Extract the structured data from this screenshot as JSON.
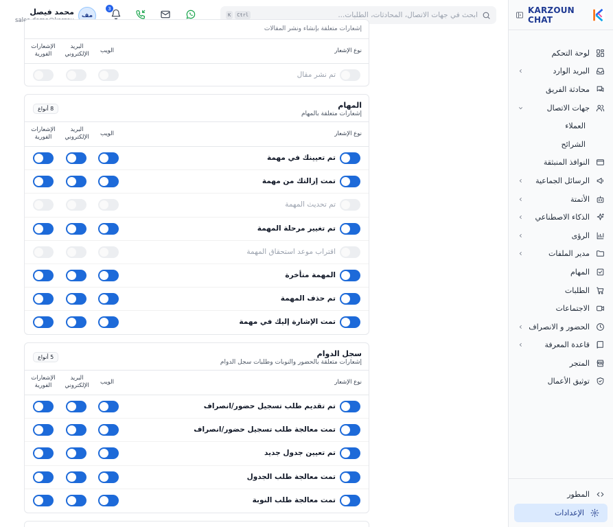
{
  "brand": {
    "name": "KARZOUN CHAT"
  },
  "search": {
    "placeholder": "ابحث في جهات الاتصال، المحادثات، الطلبات...",
    "shortcut": [
      "Ctrl",
      "K"
    ]
  },
  "topbar": {
    "notifications_count": "3"
  },
  "user": {
    "initials": "مف",
    "name": "محمد فيصل",
    "email": "sales-demo@karzoun..."
  },
  "sidebar": {
    "items": [
      {
        "label": "لوحة التحكم",
        "icon": "dashboard-icon",
        "chevron": false
      },
      {
        "label": "البريد الوارد",
        "icon": "inbox-icon",
        "chevron": true
      },
      {
        "label": "محادثة الفريق",
        "icon": "chat-icon",
        "chevron": false
      },
      {
        "label": "جهات الاتصال",
        "icon": "users-icon",
        "chevron": true,
        "expanded": true
      },
      {
        "label": "العملاء",
        "icon": "",
        "sub": true
      },
      {
        "label": "الشرائح",
        "icon": "",
        "sub": true
      },
      {
        "label": "النوافذ المنبثقة",
        "icon": "popup-icon",
        "chevron": false
      },
      {
        "label": "الرسائل الجماعية",
        "icon": "megaphone-icon",
        "chevron": true
      },
      {
        "label": "الأتمتة",
        "icon": "bot-icon",
        "chevron": true
      },
      {
        "label": "الذكاء الاصطناعي",
        "icon": "sparkles-icon",
        "chevron": true
      },
      {
        "label": "الرؤى",
        "icon": "chart-icon",
        "chevron": true
      },
      {
        "label": "مدير الملفات",
        "icon": "folder-icon",
        "chevron": true
      },
      {
        "label": "المهام",
        "icon": "task-icon",
        "chevron": false
      },
      {
        "label": "الطلبات",
        "icon": "cart-icon",
        "chevron": false
      },
      {
        "label": "الاجتماعات",
        "icon": "video-icon",
        "chevron": false
      },
      {
        "label": "الحضور و الانصراف",
        "icon": "clock-icon",
        "chevron": true
      },
      {
        "label": "قاعدة المعرفة",
        "icon": "book-icon",
        "chevron": true
      },
      {
        "label": "المتجر",
        "icon": "store-icon",
        "chevron": false
      },
      {
        "label": "توثيق الأعمال",
        "icon": "shield-check-icon",
        "chevron": false
      }
    ],
    "bottom": [
      {
        "label": "المطور",
        "icon": "code-icon"
      },
      {
        "label": "الإعدادات",
        "icon": "gear-icon",
        "active": true
      }
    ]
  },
  "columns": {
    "type": "نوع الإشعار",
    "web": "الويب",
    "email": "البريد الإلكتروني",
    "push": "الإشعارات الفورية"
  },
  "cards": {
    "top": {
      "truncated_desc": "إشعارات متعلقة بإنشاء ونشر المقالات",
      "rows": [
        {
          "label": "تم نشر مقال",
          "enabled": false
        }
      ]
    },
    "tasks": {
      "title": "المهام",
      "desc": "إشعارات متعلقة بالمهام",
      "count": "8 أنواع",
      "rows": [
        {
          "label": "تم تعيينك في مهمة",
          "enabled": true
        },
        {
          "label": "تمت إزالتك من مهمة",
          "enabled": true
        },
        {
          "label": "تم تحديث المهمة",
          "enabled": false
        },
        {
          "label": "تم تغيير مرحلة المهمة",
          "enabled": true
        },
        {
          "label": "اقتراب موعد استحقاق المهمة",
          "enabled": false
        },
        {
          "label": "المهمة متأخرة",
          "enabled": true
        },
        {
          "label": "تم حذف المهمة",
          "enabled": true
        },
        {
          "label": "تمت الإشارة إليك في مهمة",
          "enabled": true
        }
      ]
    },
    "attendance": {
      "title": "سجل الدوام",
      "desc": "إشعارات متعلقة بالحضور والنوبات وطلبات سجل الدوام",
      "count": "5 أنواع",
      "rows": [
        {
          "label": "تم تقديم طلب تسجيل حضور/انصراف",
          "enabled": true
        },
        {
          "label": "تمت معالجة طلب تسجيل حضور/انصراف",
          "enabled": true
        },
        {
          "label": "تم تعيين جدول جديد",
          "enabled": true
        },
        {
          "label": "تمت معالجة طلب الجدول",
          "enabled": true
        },
        {
          "label": "تمت معالجة طلب النوبة",
          "enabled": true
        }
      ]
    }
  },
  "colors": {
    "accent": "#1d6ad9",
    "toggle_off": "#eceef1",
    "active_nav": "#dbeafe"
  }
}
